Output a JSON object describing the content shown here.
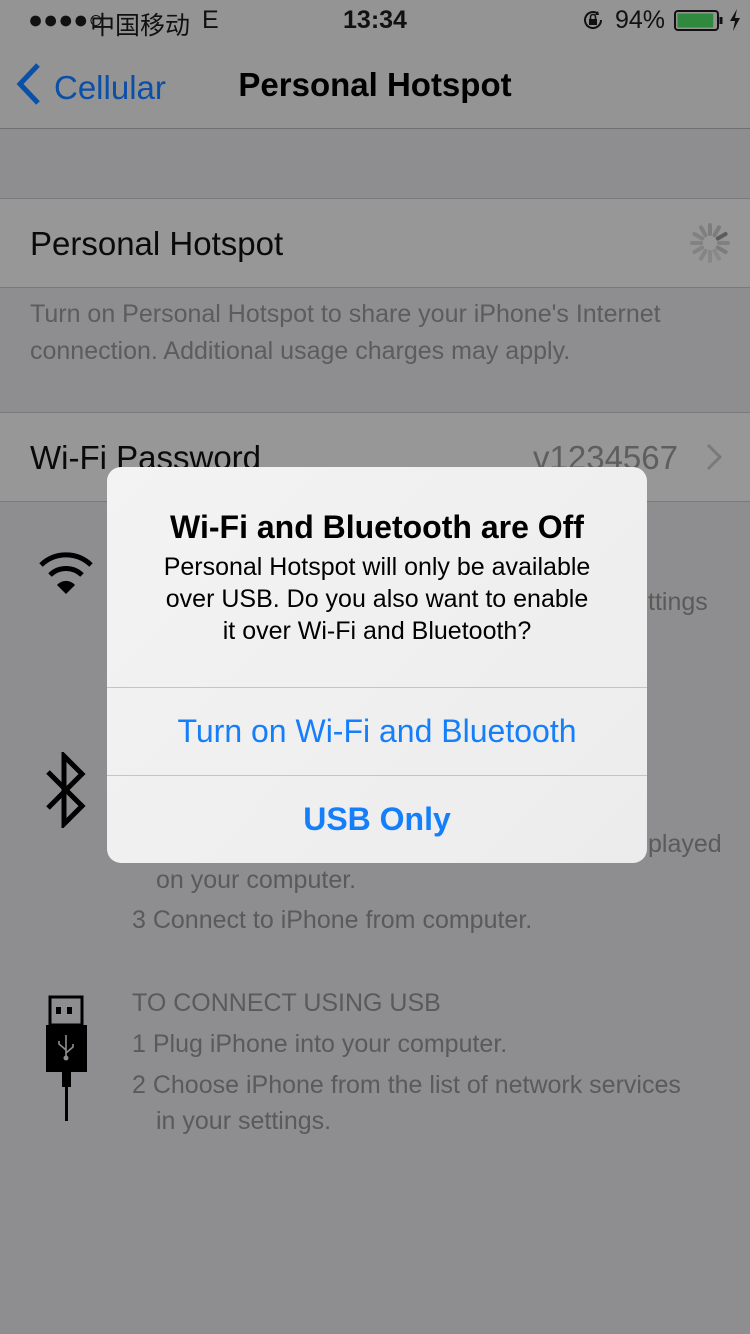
{
  "status_bar": {
    "signal": "●●●●○",
    "carrier": "中国移动",
    "network": "E",
    "time": "13:34",
    "battery_percent": "94%",
    "battery_level": 0.94,
    "icons": [
      "rotation-lock-icon",
      "battery-icon",
      "charging-icon"
    ],
    "battery_color": "#2f8a3d"
  },
  "nav": {
    "back_label": "Cellular",
    "title": "Personal Hotspot",
    "accent": "#0a4fa8"
  },
  "hotspot_row": {
    "label": "Personal Hotspot",
    "state": "loading"
  },
  "hotspot_description": "Turn on Personal Hotspot to share your iPhone's Internet connection. Additional usage charges may apply.",
  "password_row": {
    "label": "Wi-Fi Password",
    "value": "v1234567"
  },
  "partial_text": {
    "wifi_tail": "ttings",
    "bt_tail": "played",
    "bt_cont": "on your computer.",
    "bt_step3": "3 Connect to iPhone from computer."
  },
  "usb_section": {
    "heading": "TO CONNECT USING USB",
    "step1": "1 Plug iPhone into your computer.",
    "step2a": "2 Choose iPhone from the list of network services",
    "step2b": "in your settings."
  },
  "alert": {
    "title": "Wi-Fi and Bluetooth are Off",
    "message_lines": [
      "Personal Hotspot will only be available",
      "over USB. Do you also want to enable",
      "it over Wi-Fi and Bluetooth?"
    ],
    "buttons": {
      "turn_on": "Turn on Wi-Fi and Bluetooth",
      "usb_only": "USB Only"
    },
    "button_color": "#157efb"
  }
}
